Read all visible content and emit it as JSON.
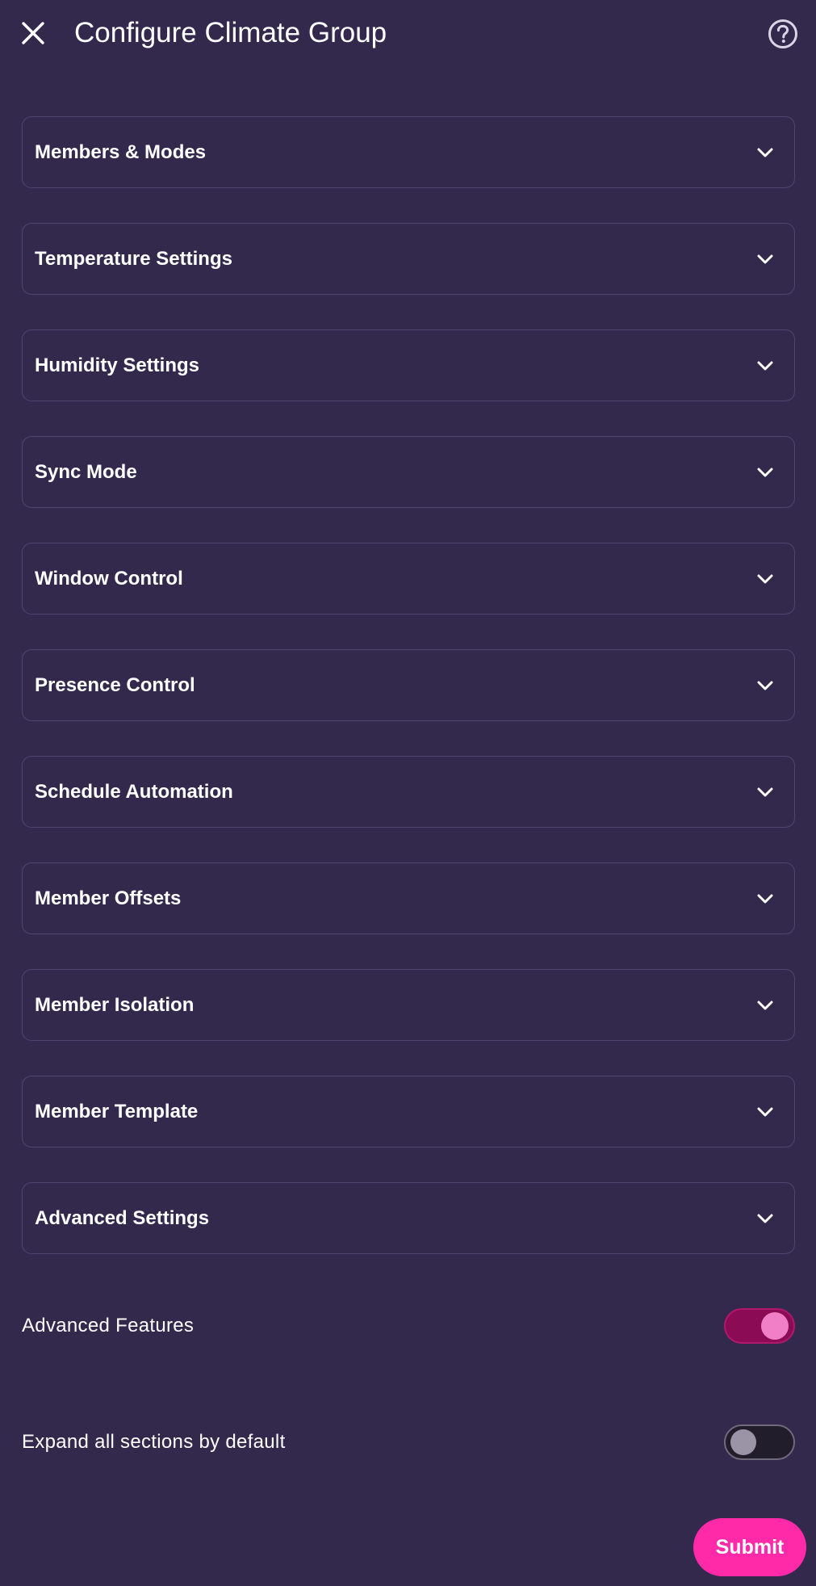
{
  "header": {
    "title": "Configure Climate Group",
    "close_icon": "close-icon",
    "help_icon": "help-circle-icon"
  },
  "sections": [
    {
      "label": "Members & Modes"
    },
    {
      "label": "Temperature Settings"
    },
    {
      "label": "Humidity Settings"
    },
    {
      "label": "Sync Mode"
    },
    {
      "label": "Window Control"
    },
    {
      "label": "Presence Control"
    },
    {
      "label": "Schedule Automation"
    },
    {
      "label": "Member Offsets"
    },
    {
      "label": "Member Isolation"
    },
    {
      "label": "Member Template"
    },
    {
      "label": "Advanced Settings"
    }
  ],
  "toggles": {
    "advanced_features": {
      "label": "Advanced Features",
      "checked": true
    },
    "expand_all": {
      "label": "Expand all sections by default",
      "checked": false
    }
  },
  "footer": {
    "submit_label": "Submit"
  },
  "colors": {
    "background": "#33294d",
    "section_border": "#4f4670",
    "accent": "#ff2aa8",
    "toggle_on_track": "#8c0b55",
    "toggle_on_knob": "#f07fc7",
    "toggle_off_track": "#211d2a",
    "toggle_off_knob": "#9a94a6"
  }
}
